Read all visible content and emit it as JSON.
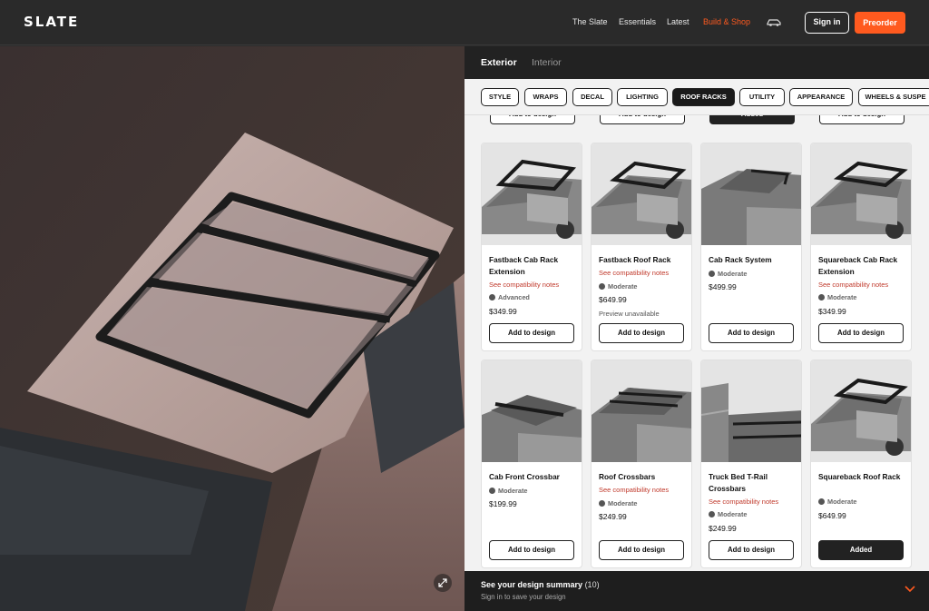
{
  "header": {
    "logo": "SLATE",
    "nav": [
      "The Slate",
      "Essentials",
      "Latest",
      "Build & Shop"
    ],
    "active_nav": "Build & Shop",
    "sign_in": "Sign in",
    "preorder": "Preorder",
    "accent_color": "#ff5a1f"
  },
  "panel": {
    "tabs": [
      "Exterior",
      "Interior"
    ],
    "categories": [
      "STYLE",
      "WRAPS",
      "DECAL",
      "LIGHTING",
      "ROOF RACKS",
      "UTILITY",
      "APPEARANCE",
      "WHEELS & SUSPE"
    ],
    "active_category": "ROOF RACKS",
    "top_row_buttons": [
      "Add to design",
      "Add to design",
      "Added",
      "Add to design"
    ],
    "products": [
      {
        "title": "Fastback Cab Rack Extension",
        "compat": "See compatibility notes",
        "difficulty": "Advanced",
        "price": "$349.99",
        "note": "",
        "button": "Add to design"
      },
      {
        "title": "Fastback Roof Rack",
        "compat": "See compatibility notes",
        "difficulty": "Moderate",
        "price": "$649.99",
        "note": "Preview unavailable",
        "button": "Add to design"
      },
      {
        "title": "Cab Rack System",
        "compat": "",
        "difficulty": "Moderate",
        "price": "$499.99",
        "note": "",
        "button": "Add to design"
      },
      {
        "title": "Squareback Cab Rack Extension",
        "compat": "See compatibility notes",
        "difficulty": "Moderate",
        "price": "$349.99",
        "note": "",
        "button": "Add to design"
      },
      {
        "title": "Cab Front Crossbar",
        "compat": "",
        "difficulty": "Moderate",
        "price": "$199.99",
        "note": "",
        "button": "Add to design"
      },
      {
        "title": "Roof Crossbars",
        "compat": "See compatibility notes",
        "difficulty": "Moderate",
        "price": "$249.99",
        "note": "",
        "button": "Add to design"
      },
      {
        "title": "Truck Bed T-Rail Crossbars",
        "compat": "See compatibility notes",
        "difficulty": "Moderate",
        "price": "$249.99",
        "note": "",
        "button": "Add to design"
      },
      {
        "title": "Squareback Roof Rack",
        "compat": "",
        "difficulty": "Moderate",
        "price": "$649.99",
        "note": "",
        "button": "Added"
      }
    ]
  },
  "summary": {
    "title": "See your design summary",
    "count": "(10)",
    "subtitle": "Sign in to save your design"
  }
}
